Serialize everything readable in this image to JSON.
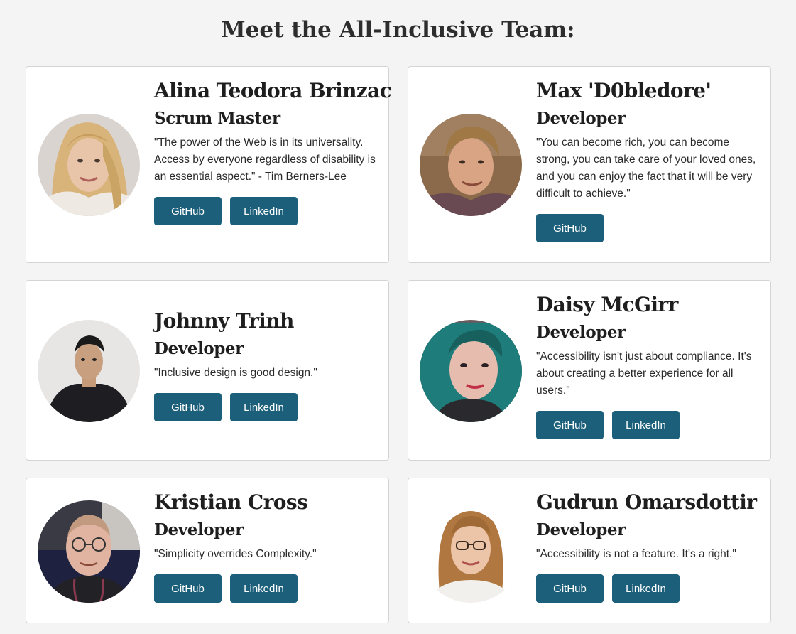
{
  "title": "Meet the All-Inclusive Team:",
  "members": [
    {
      "name": "Alina Teodora Brinzac",
      "role": "Scrum Master",
      "quote": "\"The power of the Web is in its universality. Access by everyone regardless of disability is an essential aspect.\" - Tim Berners-Lee",
      "github": "GitHub",
      "linkedin": "LinkedIn",
      "photo": "woman-blonde-hair-photo"
    },
    {
      "name": "Max 'D0bledore'",
      "role": "Developer",
      "quote": "\"You can become rich, you can become strong, you can take care of your loved ones, and you can enjoy the fact that it will be very difficult to achieve.\"",
      "github": "GitHub",
      "photo": "man-tousled-hair-photo"
    },
    {
      "name": "Johnny Trinh",
      "role": "Developer",
      "quote": "\"Inclusive design is good design.\"",
      "github": "GitHub",
      "linkedin": "LinkedIn",
      "photo": "man-black-tshirt-photo"
    },
    {
      "name": "Daisy McGirr",
      "role": "Developer",
      "quote": "\"Accessibility isn't just about compliance. It's about creating a better experience for all users.\"",
      "github": "GitHub",
      "linkedin": "LinkedIn",
      "photo": "woman-teal-hair-photo"
    },
    {
      "name": "Kristian Cross",
      "role": "Developer",
      "quote": "\"Simplicity overrides Complexity.\"",
      "github": "GitHub",
      "linkedin": "LinkedIn",
      "photo": "man-glasses-headphones-photo"
    },
    {
      "name": "Gudrun Omarsdottir",
      "role": "Developer",
      "quote": "\"Accessibility is not a feature. It's a right.\"",
      "github": "GitHub",
      "linkedin": "LinkedIn",
      "photo": "woman-glasses-photo"
    }
  ],
  "colors": {
    "button": "#1c5f7a",
    "page_background": "#f4f4f4"
  }
}
